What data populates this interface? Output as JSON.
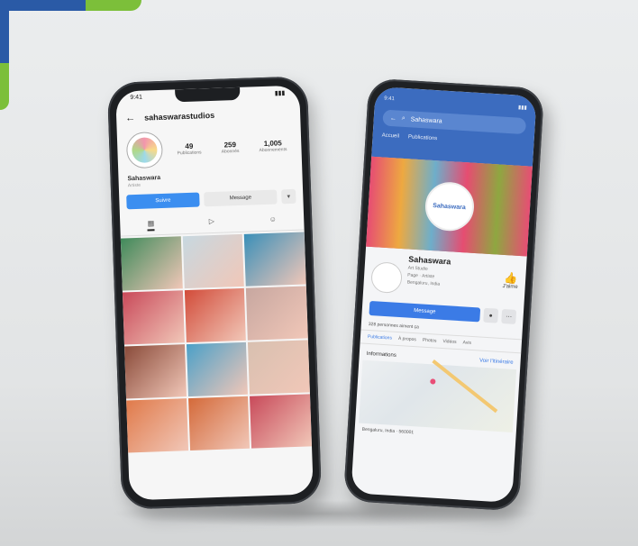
{
  "instagram": {
    "status_time": "9:41",
    "username": "sahaswarastudios",
    "posts_count": "49",
    "posts_label": "Publications",
    "followers_count": "259",
    "followers_label": "Abonnés",
    "following_count": "1,005",
    "following_label": "Abonnements",
    "display_name": "Sahaswara",
    "bio": "Artiste",
    "follow_label": "Suivre",
    "message_label": "Message",
    "more_label": "▾",
    "tab_grid": "▦",
    "tab_reels": "▷",
    "tab_tagged": "☺",
    "grid_colors": [
      "#3f8a5a",
      "#c7d8e0",
      "#3a8fb8",
      "#c94a5a",
      "#d24c3a",
      "#c7a7a0",
      "#8a4b3a",
      "#4ba0c8",
      "#d8c0b0",
      "#e07a4a",
      "#d46a3a",
      "#c84a5a"
    ]
  },
  "facebook": {
    "status_time": "9:41",
    "search_text": "Sahaswara",
    "tabs": [
      "Accueil",
      "Publications"
    ],
    "cover_logo_text": "Sahaswara",
    "page_name": "Sahaswara",
    "line1": "Art Studio",
    "line2": "Page · Artiste",
    "line3": "Bengaluru, India",
    "like_label": "J'aime",
    "message_label": "Message",
    "icon_btn_1": "●",
    "icon_btn_2": "⋯",
    "followers_text": "328 personnes aiment ça",
    "nav": [
      "Publications",
      "À propos",
      "Photos",
      "Vidéos",
      "Avis"
    ],
    "section_title": "Informations",
    "section_link": "Voir l'itinéraire",
    "address": "Bengaluru, India · 560001"
  },
  "colors": {
    "brand_blue": "#2a5aa6",
    "brand_green": "#7cbf3a",
    "ig_blue": "#3b8ef0",
    "fb_blue": "#3c6cbf"
  }
}
